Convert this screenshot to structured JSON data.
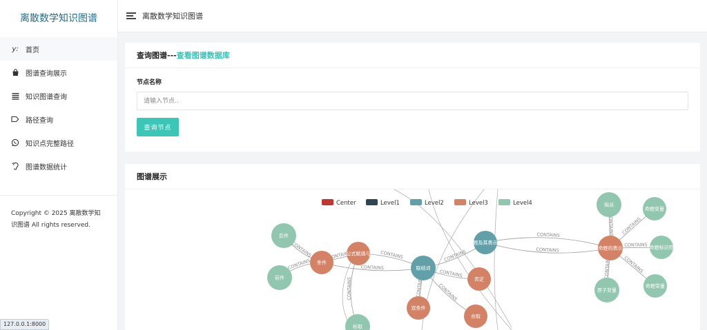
{
  "brand": {
    "title": "离散数学知识图谱"
  },
  "sidebar": {
    "items": [
      {
        "label": "首页",
        "icon": "y-axis-icon"
      },
      {
        "label": "图谱查询展示",
        "icon": "bag-icon"
      },
      {
        "label": "知识图谱查询",
        "icon": "list-icon"
      },
      {
        "label": "路径查询",
        "icon": "tag-icon"
      },
      {
        "label": "知识点完整路径",
        "icon": "whatsapp-icon"
      },
      {
        "label": "图谱数据统计",
        "icon": "ear-icon"
      }
    ],
    "copyright": "Copyright © 2025 离散数学知识图谱 All rights reserved."
  },
  "topbar": {
    "title": "离散数学知识图谱"
  },
  "query_card": {
    "title_prefix": "查询图谱---",
    "title_link": "查看图谱数据库",
    "field_label": "节点名称",
    "input_placeholder": "请输入节点..",
    "input_value": "",
    "button_label": "查询节点"
  },
  "graph_card": {
    "title": "图谱展示",
    "legend": [
      {
        "label": "Center",
        "color": "#c23531"
      },
      {
        "label": "Level1",
        "color": "#2f4554"
      },
      {
        "label": "Level2",
        "color": "#61a0a8"
      },
      {
        "label": "Level3",
        "color": "#d48265"
      },
      {
        "label": "Level4",
        "color": "#91c7ae"
      }
    ],
    "nodes": [
      {
        "id": "houjian",
        "label": "后件",
        "level": 4
      },
      {
        "id": "qianjian",
        "label": "前件",
        "level": 4
      },
      {
        "id": "tiaojian",
        "label": "条件",
        "level": 3
      },
      {
        "id": "gongshi",
        "label": "公式赋值与",
        "level": 3
      },
      {
        "id": "lianjieci",
        "label": "联结词",
        "level": 2
      },
      {
        "id": "foudin",
        "label": "否定",
        "level": 3
      },
      {
        "id": "shuangtiaojian",
        "label": "双条件",
        "level": 3
      },
      {
        "id": "hequ",
        "label": "合取",
        "level": 3
      },
      {
        "id": "tijibiao",
        "label": "题及其表示",
        "level": 2
      },
      {
        "id": "mingti",
        "label": "命题的表示",
        "level": 3
      },
      {
        "id": "zhijie",
        "label": "指派",
        "level": 4
      },
      {
        "id": "mtbl",
        "label": "命题变量",
        "level": 4
      },
      {
        "id": "mtbsf",
        "label": "命题标识符",
        "level": 4
      },
      {
        "id": "mtcl",
        "label": "命题常量",
        "level": 4
      },
      {
        "id": "yzbl",
        "label": "原子变量",
        "level": 4
      },
      {
        "id": "bottom",
        "label": "析取",
        "level": 4
      }
    ],
    "edge_label": "CONTAINS"
  },
  "status": {
    "url": "127.0.0.1:8000"
  }
}
